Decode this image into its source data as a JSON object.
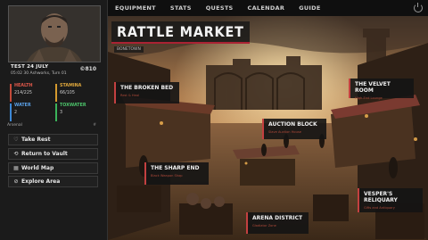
{
  "nav": {
    "items": [
      "EQUIPMENT",
      "STATS",
      "QUESTS",
      "CALENDAR",
      "GUIDE"
    ]
  },
  "player": {
    "date": "TEST 24 JULY",
    "time_location": "05:02  30 Ashworks, Turn 01",
    "money": "©810"
  },
  "stats": {
    "health": {
      "label": "HEALTH",
      "value": "214/225"
    },
    "stamina": {
      "label": "STAMINA",
      "value": "66/105"
    },
    "water": {
      "label": "WATER",
      "value": "2"
    },
    "toxwater": {
      "label": "TOXWATER",
      "value": "3"
    }
  },
  "section_label": "Arsenal",
  "section_hash": "#",
  "actions": [
    {
      "label": "Take Rest",
      "icon": "heart-icon"
    },
    {
      "label": "Return to Vault",
      "icon": "return-icon"
    },
    {
      "label": "World Map",
      "icon": "map-icon"
    },
    {
      "label": "Explore Area",
      "icon": "compass-icon"
    }
  ],
  "location": {
    "title": "RATTLE MARKET",
    "subtitle": "BONETOWN"
  },
  "places": {
    "broken_bed": {
      "name": "THE BROKEN BED",
      "desc": "Rest & Heal"
    },
    "velvet_room": {
      "name": "THE VELVET ROOM",
      "desc": "High-End Lounge"
    },
    "auction_block": {
      "name": "AUCTION BLOCK",
      "desc": "Slave Auction House"
    },
    "sharp_end": {
      "name": "THE SHARP END",
      "desc": "Black Weapon Shop"
    },
    "vespers": {
      "name": "VESPER'S RELIQUARY",
      "desc": "Gifts and Antiquary"
    },
    "arena": {
      "name": "ARENA DISTRICT",
      "desc": "Gladiator Zone"
    }
  },
  "colors": {
    "accent": "#c34040",
    "health": "#c34a3a",
    "stamina": "#d59a2e",
    "water": "#3d88d6",
    "toxwater": "#3bb35a"
  }
}
